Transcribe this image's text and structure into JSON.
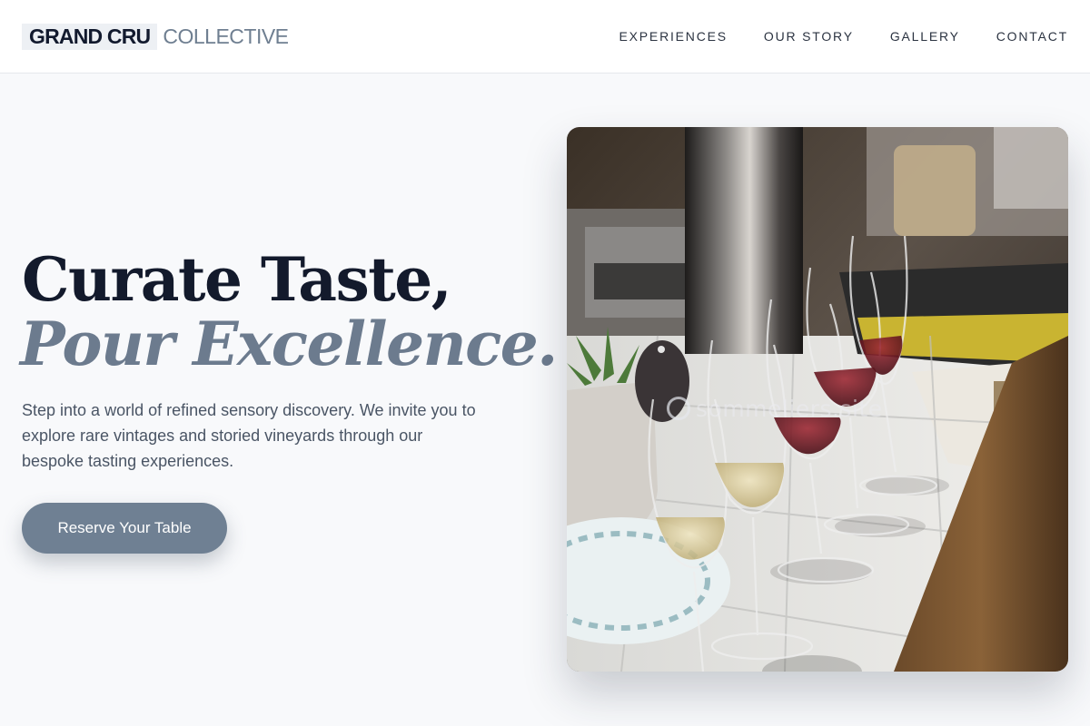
{
  "brand": {
    "name_primary": "GRAND CRU",
    "name_secondary": "COLLECTIVE"
  },
  "nav": {
    "items": [
      {
        "label": "EXPERIENCES"
      },
      {
        "label": "OUR STORY"
      },
      {
        "label": "GALLERY"
      },
      {
        "label": "CONTACT"
      }
    ]
  },
  "hero": {
    "headline_line1": "Curate Taste,",
    "headline_line2": "Pour Excellence.",
    "subcopy": "Step into a world of refined sensory discovery. We invite you to explore rare vintages and storied vineyards through our bespoke tasting experiences.",
    "cta_label": "Reserve Your Table"
  },
  "image": {
    "subject": "wine glasses with red and white wine on a tiled tasting table",
    "watermark_text": "sommeliers.site"
  },
  "colors": {
    "page_background": "#f8f9fb",
    "headline_dark": "#131a2c",
    "headline_accent": "#6c7b8e",
    "button": "#6f8093",
    "nav_text": "#2b3341"
  }
}
